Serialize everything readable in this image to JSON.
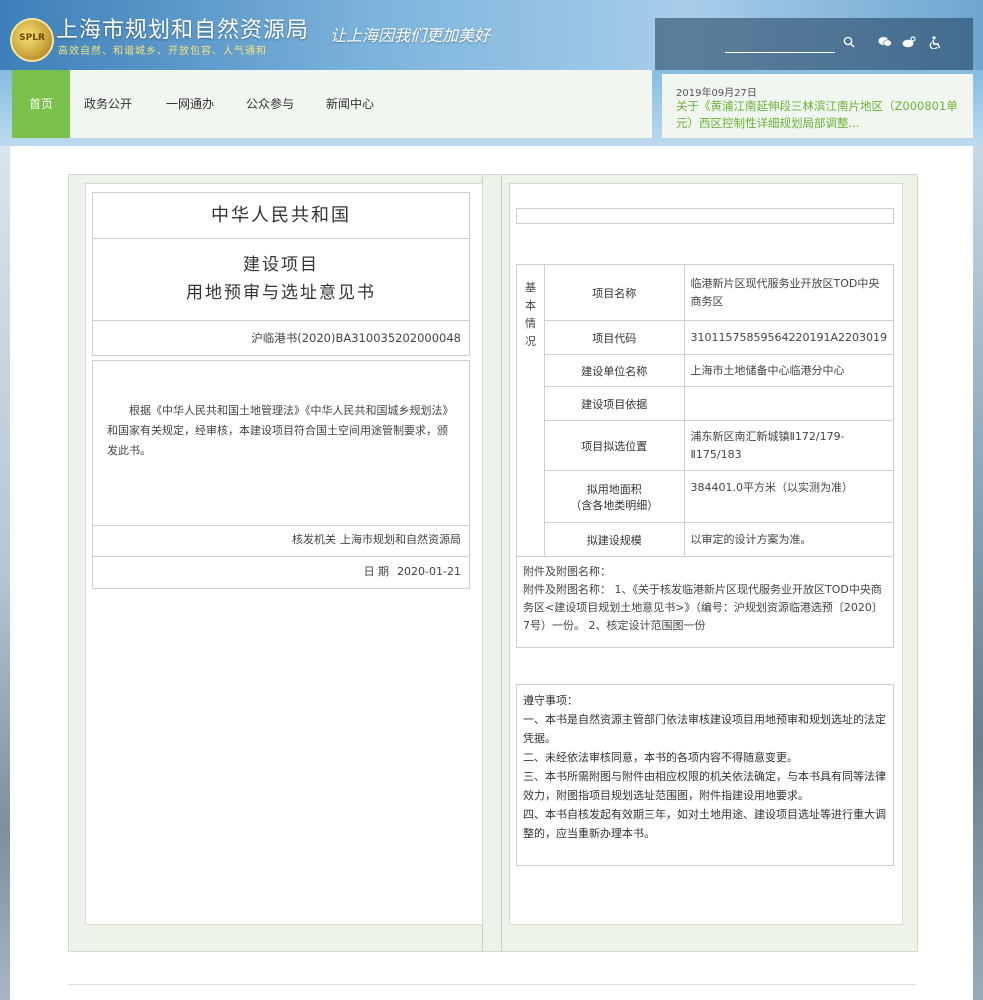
{
  "header": {
    "logo_text": "SPLR",
    "site_title": "上海市规划和自然资源局",
    "site_subtitle": "高效自然、和谐城乡、开放包容、人气通和",
    "slogan": "让上海因我们更加美好",
    "search": {
      "value": "",
      "placeholder": ""
    },
    "icons": [
      "search-icon",
      "wechat-icon",
      "weibo-icon",
      "accessibility-icon"
    ]
  },
  "nav": {
    "items": [
      {
        "label": "首页",
        "active": true
      },
      {
        "label": "政务公开"
      },
      {
        "label": "一网通办"
      },
      {
        "label": "公众参与"
      },
      {
        "label": "新闻中心"
      }
    ]
  },
  "news": {
    "date": "2019年09月27日",
    "link": "关于《黄浦江南延伸段三林滨江南片地区（Z000801单元）西区控制性详细规划局部调整..."
  },
  "certificate": {
    "country": "中华人民共和国",
    "title_line1": "建设项目",
    "title_line2": "用地预审与选址意见书",
    "code": "沪临港书(2020)BA310035202000048",
    "body": "根据《中华人民共和国土地管理法》《中华人民共和国城乡规划法》和国家有关规定，经审核，本建设项目符合国土空间用途管制要求，颁发此书。",
    "issuer_label": "核发机关",
    "issuer": "上海市规划和自然资源局",
    "date_label": "日 期",
    "date": "2020-01-21"
  },
  "details": {
    "side_label": "基本情况",
    "rows": [
      {
        "label": "项目名称",
        "value": "临港新片区现代服务业开放区TOD中央商务区"
      },
      {
        "label": "项目代码",
        "value": "31011575859564220191A2203019"
      },
      {
        "label": "建设单位名称",
        "value": "上海市土地储备中心临港分中心"
      },
      {
        "label": "建设项目依据",
        "value": ""
      },
      {
        "label": "项目拟选位置",
        "value": "浦东新区南汇新城镇Ⅱ172/179-Ⅱ175/183"
      },
      {
        "label": "拟用地面积（含各地类明细）",
        "label_line1": "拟用地面积",
        "label_line2": "（含各地类明细）",
        "value": "384401.0平方米（以实测为准）"
      },
      {
        "label": "拟建设规模",
        "value": "以审定的设计方案为准。"
      }
    ],
    "attachments_title": "附件及附图名称：",
    "attachments": "附件及附图名称： 1、《关于核发临港新片区现代服务业开放区TOD中央商务区<建设项目规划土地意见书>》（编号：沪规划资源临港选预〔2020〕7号）一份。 2、核定设计范围图一份",
    "notes": [
      "遵守事项：",
      "一、本书是自然资源主管部门依法审核建设项目用地预审和规划选址的法定凭据。",
      "二、未经依法审核同意，本书的各项内容不得随意变更。",
      "三、本书所需附图与附件由相应权限的机关依法确定，与本书具有同等法律效力，附图指项目规划选址范围图，附件指建设用地要求。",
      "四、本书自核发起有效期三年，如对土地用途、建设项目选址等进行重大调整的，应当重新办理本书。"
    ]
  }
}
